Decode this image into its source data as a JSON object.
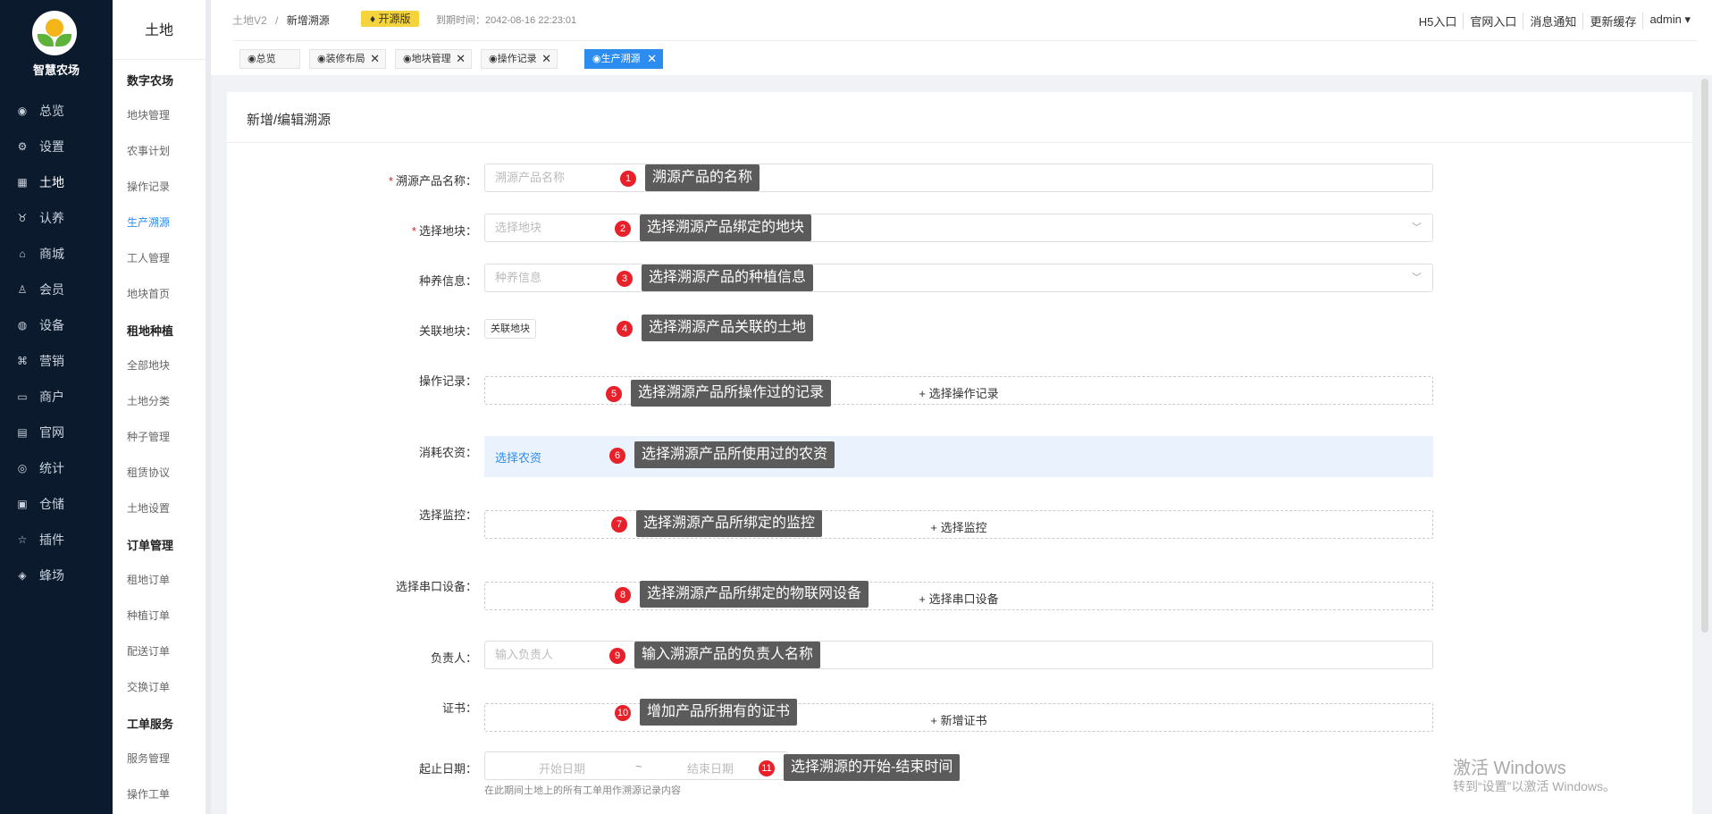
{
  "sidebar": {
    "brand": "智慧农场",
    "items": [
      {
        "label": "总览",
        "icon": "dashboard-icon",
        "glyph": "◉"
      },
      {
        "label": "设置",
        "icon": "gear-icon",
        "glyph": "⚙"
      },
      {
        "label": "土地",
        "icon": "grid-icon",
        "glyph": "▦"
      },
      {
        "label": "认养",
        "icon": "cow-icon",
        "glyph": "♉"
      },
      {
        "label": "商城",
        "icon": "store-icon",
        "glyph": "⌂"
      },
      {
        "label": "会员",
        "icon": "member-icon",
        "glyph": "♙"
      },
      {
        "label": "设备",
        "icon": "device-icon",
        "glyph": "◍"
      },
      {
        "label": "营销",
        "icon": "marketing-icon",
        "glyph": "⌘"
      },
      {
        "label": "商户",
        "icon": "merchant-icon",
        "glyph": "▭"
      },
      {
        "label": "官网",
        "icon": "website-icon",
        "glyph": "▤"
      },
      {
        "label": "统计",
        "icon": "stats-icon",
        "glyph": "◎"
      },
      {
        "label": "仓储",
        "icon": "warehouse-icon",
        "glyph": "▣"
      },
      {
        "label": "插件",
        "icon": "plugin-icon",
        "glyph": "☆"
      },
      {
        "label": "蜂场",
        "icon": "bee-icon",
        "glyph": "◈"
      }
    ]
  },
  "submenu": {
    "title": "土地",
    "groups": [
      {
        "title": "数字农场",
        "items": [
          "地块管理",
          "农事计划",
          "操作记录",
          "生产溯源",
          "工人管理",
          "地块首页"
        ]
      },
      {
        "title": "租地种植",
        "items": [
          "全部地块",
          "土地分类",
          "种子管理",
          "租赁协议",
          "土地设置"
        ]
      },
      {
        "title": "订单管理",
        "items": [
          "租地订单",
          "种植订单",
          "配送订单",
          "交换订单"
        ]
      },
      {
        "title": "工单服务",
        "items": [
          "服务管理",
          "操作工单"
        ]
      }
    ]
  },
  "header": {
    "breadcrumb_root": "土地V2",
    "breadcrumb_sep": "/",
    "breadcrumb_current": "新增溯源",
    "badge": "开源版",
    "expire": "到期时间：2042-08-16 22:23:01",
    "nav": [
      "H5入口",
      "官网入口",
      "消息通知",
      "更新缓存",
      "admin ▾"
    ]
  },
  "tabs": [
    {
      "label": "◉总览",
      "closable": false
    },
    {
      "label": "◉装修布局",
      "closable": true
    },
    {
      "label": "◉地块管理",
      "closable": true
    },
    {
      "label": "◉操作记录",
      "closable": true
    },
    {
      "label": "◉生产溯源",
      "closable": true,
      "active": true
    }
  ],
  "card": {
    "title": "新增/编辑溯源",
    "fields": {
      "name": {
        "label": "溯源产品名称：",
        "placeholder": "溯源产品名称"
      },
      "plot": {
        "label": "选择地块：",
        "placeholder": "选择地块"
      },
      "breed": {
        "label": "种养信息：",
        "placeholder": "种养信息"
      },
      "linked": {
        "label": "关联地块：",
        "button": "关联地块"
      },
      "ops": {
        "label": "操作记录：",
        "add": "+ 选择操作记录"
      },
      "farm": {
        "label": "消耗农资：",
        "link": "选择农资"
      },
      "monitor": {
        "label": "选择监控：",
        "add": "+ 选择监控"
      },
      "serial": {
        "label": "选择串口设备：",
        "add": "+ 选择串口设备"
      },
      "owner": {
        "label": "负责人：",
        "placeholder": "输入负责人"
      },
      "cert": {
        "label": "证书：",
        "add": "+ 新增证书"
      },
      "date": {
        "label": "起止日期：",
        "start": "开始日期",
        "sep": "~",
        "end": "结束日期",
        "hint": "在此期间土地上的所有工单用作溯源记录内容"
      }
    }
  },
  "callouts": [
    {
      "n": "1",
      "text": "溯源产品的名称"
    },
    {
      "n": "2",
      "text": "选择溯源产品绑定的地块"
    },
    {
      "n": "3",
      "text": "选择溯源产品的种植信息"
    },
    {
      "n": "4",
      "text": "选择溯源产品关联的土地"
    },
    {
      "n": "5",
      "text": "选择溯源产品所操作过的记录"
    },
    {
      "n": "6",
      "text": "选择溯源产品所使用过的农资"
    },
    {
      "n": "7",
      "text": "选择溯源产品所绑定的监控"
    },
    {
      "n": "8",
      "text": "选择溯源产品所绑定的物联网设备"
    },
    {
      "n": "9",
      "text": "输入溯源产品的负责人名称"
    },
    {
      "n": "10",
      "text": "增加产品所拥有的证书"
    },
    {
      "n": "11",
      "text": "选择溯源的开始-结束时间"
    }
  ],
  "watermark": {
    "line1": "激活 Windows",
    "line2": "转到“设置”以激活 Windows。"
  },
  "colors": {
    "sidebar": "#0b1a2d",
    "accent": "#2d8cf0",
    "badge": "#f5d43b",
    "marker": "#e8202a"
  }
}
